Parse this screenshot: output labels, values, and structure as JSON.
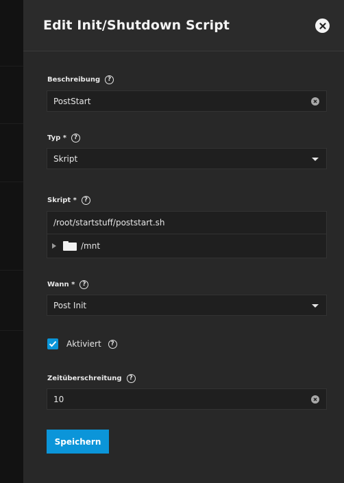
{
  "dialog": {
    "title": "Edit Init/Shutdown Script",
    "close_icon": "close-icon"
  },
  "form": {
    "description": {
      "label": "Beschreibung",
      "value": "PostStart"
    },
    "type": {
      "label": "Typ *",
      "value": "Skript"
    },
    "script": {
      "label": "Skript *",
      "path": "/root/startstuff/poststart.sh",
      "tree": {
        "items": [
          {
            "label": "/mnt"
          }
        ]
      }
    },
    "when": {
      "label": "Wann *",
      "value": "Post Init"
    },
    "enabled": {
      "label": "Aktiviert",
      "checked": true
    },
    "timeout": {
      "label": "Zeitüberschreitung",
      "value": "10"
    },
    "save_label": "Speichern"
  },
  "icons": {
    "help": "?"
  },
  "colors": {
    "accent": "#0b95d9",
    "panel_bg": "#282828",
    "field_bg": "#1f1f1f"
  }
}
